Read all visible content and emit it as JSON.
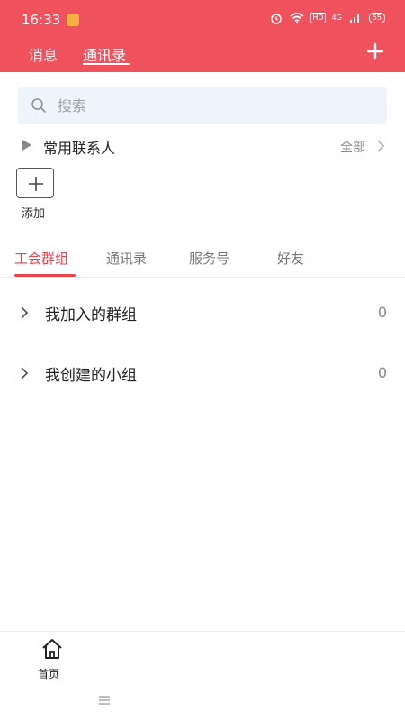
{
  "status_bar": {
    "time": "16:33",
    "hd": "HD",
    "network": "4G",
    "battery": "55"
  },
  "header": {
    "tabs": [
      {
        "label": "消息",
        "active": false
      },
      {
        "label": "通讯录",
        "active": true
      }
    ],
    "accent_color": "#ef525d"
  },
  "search": {
    "placeholder": "搜索"
  },
  "favorites": {
    "title": "常用联系人",
    "all_label": "全部"
  },
  "add": {
    "label": "添加"
  },
  "sub_tabs": [
    {
      "label": "工会群组",
      "active": true
    },
    {
      "label": "通讯录",
      "active": false
    },
    {
      "label": "服务号",
      "active": false
    },
    {
      "label": "好友",
      "active": false
    }
  ],
  "groups": [
    {
      "label": "我加入的群组",
      "count": "0"
    },
    {
      "label": "我创建的小组",
      "count": "0"
    }
  ],
  "bottom_nav": {
    "home_label": "首页"
  }
}
